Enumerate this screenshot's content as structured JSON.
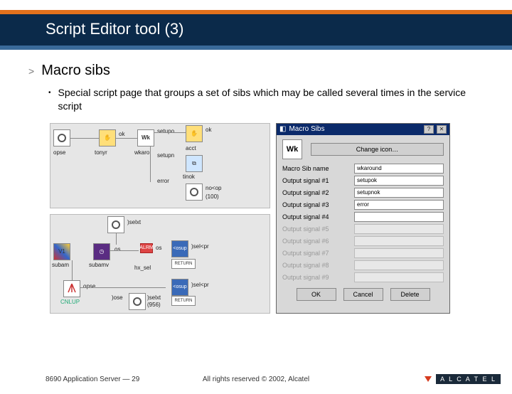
{
  "header": {
    "title": "Script Editor tool (3)"
  },
  "bullets": {
    "gt": ">",
    "dot": "•",
    "macro": "Macro sibs",
    "desc": "Special script page that groups a set of sibs which may be called several times in the service script"
  },
  "panelA": {
    "opse": "opse",
    "ok1": "ok",
    "tonyr": "tonyr",
    "wkaro": "wkaro",
    "wk": "Wk",
    "setupo": "setupo",
    "ok2": "ok",
    "acct": "acct",
    "setupn": "setupn",
    "tinok": "tinok",
    "error": "error",
    "noop": "no<op",
    "hund": "(100)"
  },
  "panelB": {
    "v1": "V1",
    "subam": "subam",
    "subamv": "subamv",
    "os": "os",
    "selxt": ")selxt",
    "alrm": "ALRM",
    "osup": "<osup",
    "selup": ")sel<pr",
    "return": "RETURN",
    "hxsel": "hx_sel",
    "cnlup": "CNLUP",
    "opse": "opse",
    "ose": ")ose",
    "selxtb": ")selxt",
    "num": "(956)"
  },
  "dialog": {
    "title": "Macro Sibs",
    "icon": "Wk",
    "changeIcon": "Change icon…",
    "nameLabel": "Macro Sib name",
    "nameVal": "wkaround",
    "s1": "Output signal #1",
    "s1v": "setupok",
    "s2": "Output signal #2",
    "s2v": "setupnok",
    "s3": "Output signal #3",
    "s3v": "error",
    "s4": "Output signal #4",
    "s5": "Output signal #5",
    "s6": "Output signal #6",
    "s7": "Output signal #7",
    "s8": "Output signal #8",
    "s9": "Output signal #9",
    "ok": "OK",
    "cancel": "Cancel",
    "delete": "Delete"
  },
  "footer": {
    "left": "8690 Application Server — 29",
    "center": "All rights reserved © 2002, Alcatel",
    "brand": "A L C A T E L"
  }
}
